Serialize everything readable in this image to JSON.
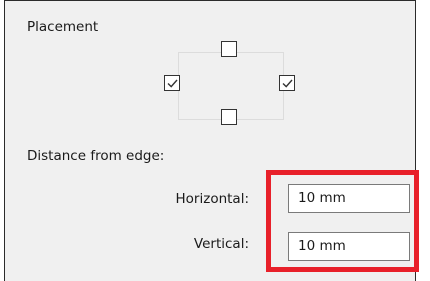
{
  "placement": {
    "title": "Placement",
    "top_checked": false,
    "left_checked": true,
    "right_checked": true,
    "bottom_checked": false
  },
  "distance": {
    "label": "Distance from edge:",
    "horizontal_label": "Horizontal:",
    "horizontal_value": "10 mm",
    "vertical_label": "Vertical:",
    "vertical_value": "10 mm"
  },
  "colors": {
    "highlight": "#e8202a",
    "panel_background": "#f0f0f0"
  }
}
